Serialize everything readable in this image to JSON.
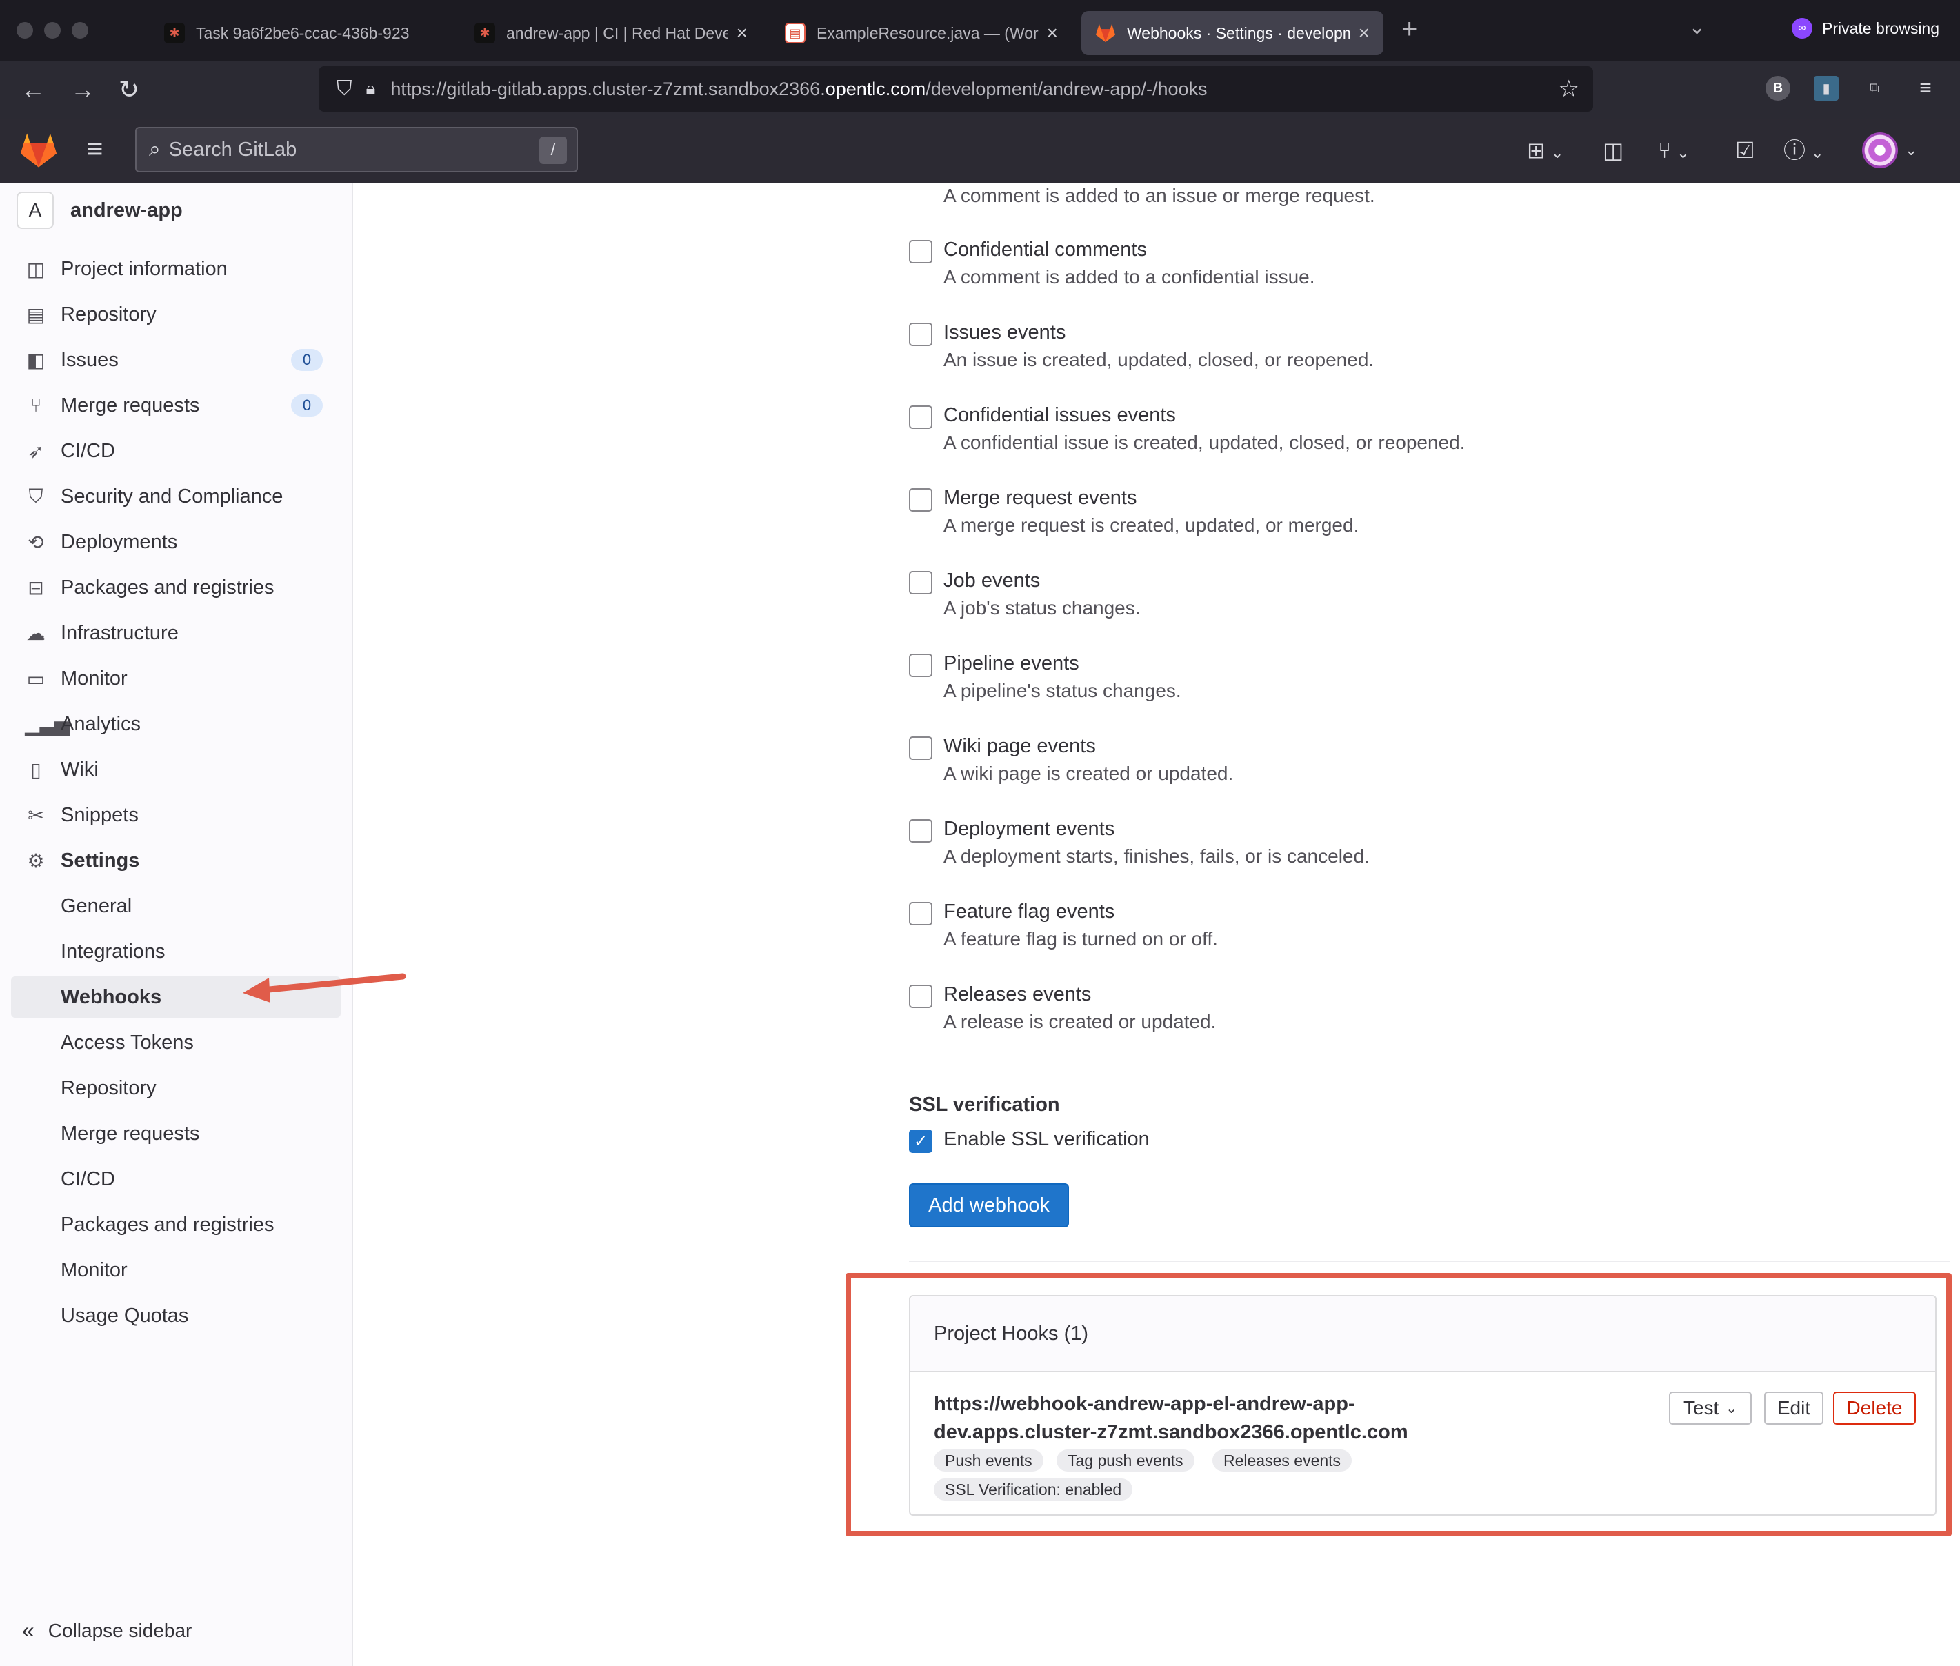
{
  "browser": {
    "tabs": [
      {
        "title": "Task 9a6f2be6-ccac-436b-923",
        "active": false
      },
      {
        "title": "andrew-app | CI | Red Hat Devel",
        "active": false
      },
      {
        "title": "ExampleResource.java — (Work",
        "active": false
      },
      {
        "title": "Webhooks · Settings · developm",
        "active": true
      }
    ],
    "private_label": "Private browsing",
    "url_prefix": "https://gitlab-gitlab.apps.cluster-z7zmt.sandbox2366.",
    "url_domain": "opentlc.com",
    "url_suffix": "/development/andrew-app/-/hooks"
  },
  "header": {
    "search_placeholder": "Search GitLab",
    "search_shortcut": "/"
  },
  "sidebar": {
    "project_letter": "A",
    "project_name": "andrew-app",
    "items": [
      {
        "label": "Project information",
        "icon": "info-icon"
      },
      {
        "label": "Repository",
        "icon": "doc-icon"
      },
      {
        "label": "Issues",
        "icon": "issues-icon",
        "badge": "0"
      },
      {
        "label": "Merge requests",
        "icon": "merge-icon",
        "badge": "0"
      },
      {
        "label": "CI/CD",
        "icon": "rocket-icon"
      },
      {
        "label": "Security and Compliance",
        "icon": "shield-icon"
      },
      {
        "label": "Deployments",
        "icon": "deploy-icon"
      },
      {
        "label": "Packages and registries",
        "icon": "package-icon"
      },
      {
        "label": "Infrastructure",
        "icon": "cloud-icon"
      },
      {
        "label": "Monitor",
        "icon": "monitor-icon"
      },
      {
        "label": "Analytics",
        "icon": "chart-icon"
      },
      {
        "label": "Wiki",
        "icon": "book-icon"
      },
      {
        "label": "Snippets",
        "icon": "scissors-icon"
      },
      {
        "label": "Settings",
        "icon": "gear-icon"
      }
    ],
    "settings_sub": [
      "General",
      "Integrations",
      "Webhooks",
      "Access Tokens",
      "Repository",
      "Merge requests",
      "CI/CD",
      "Packages and registries",
      "Monitor",
      "Usage Quotas"
    ],
    "active_sub": "Webhooks",
    "collapse_label": "Collapse sidebar"
  },
  "main": {
    "top_desc": "A comment is added to an issue or merge request.",
    "events": [
      {
        "title": "Confidential comments",
        "desc": "A comment is added to a confidential issue.",
        "checked": false
      },
      {
        "title": "Issues events",
        "desc": "An issue is created, updated, closed, or reopened.",
        "checked": false
      },
      {
        "title": "Confidential issues events",
        "desc": "A confidential issue is created, updated, closed, or reopened.",
        "checked": false
      },
      {
        "title": "Merge request events",
        "desc": "A merge request is created, updated, or merged.",
        "checked": false
      },
      {
        "title": "Job events",
        "desc": "A job's status changes.",
        "checked": false
      },
      {
        "title": "Pipeline events",
        "desc": "A pipeline's status changes.",
        "checked": false
      },
      {
        "title": "Wiki page events",
        "desc": "A wiki page is created or updated.",
        "checked": false
      },
      {
        "title": "Deployment events",
        "desc": "A deployment starts, finishes, fails, or is canceled.",
        "checked": false
      },
      {
        "title": "Feature flag events",
        "desc": "A feature flag is turned on or off.",
        "checked": false
      },
      {
        "title": "Releases events",
        "desc": "A release is created or updated.",
        "checked": false
      }
    ],
    "ssl_heading": "SSL verification",
    "ssl_label": "Enable SSL verification",
    "ssl_checked": true,
    "add_button": "Add webhook"
  },
  "hooks": {
    "title": "Project Hooks (1)",
    "url": "https://webhook-andrew-app-el-andrew-app-dev.apps.cluster-z7zmt.sandbox2366.opentlc.com",
    "tags": [
      "Push events",
      "Tag push events",
      "Releases events"
    ],
    "ssl_tag": "SSL Verification: enabled",
    "test_label": "Test",
    "edit_label": "Edit",
    "delete_label": "Delete"
  },
  "colors": {
    "accent": "#1f75cb",
    "annotation": "#e05c4a",
    "danger": "#dd2b0e"
  }
}
